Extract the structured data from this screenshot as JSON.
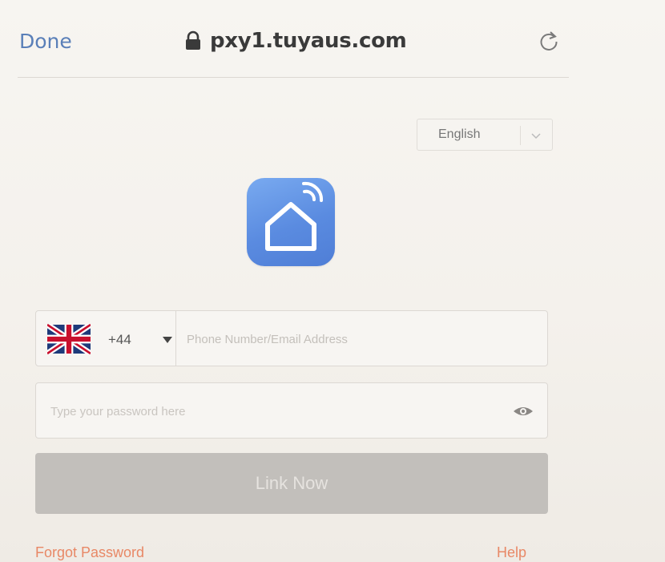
{
  "browser": {
    "done_label": "Done",
    "url": "pxy1.tuyaus.com",
    "lock_icon": "lock-icon",
    "reload_icon": "reload-icon"
  },
  "language": {
    "selected": "English",
    "icon": "chevron-down-icon"
  },
  "logo": {
    "icon": "smart-home-icon",
    "colors": {
      "from": "#79aaf0",
      "to": "#4f7ed6"
    }
  },
  "login": {
    "country_flag": "uk-flag-icon",
    "country_code": "+44",
    "phone_placeholder": "Phone Number/Email Address",
    "password_placeholder": "Type your password here",
    "eye_icon": "eye-icon",
    "submit_label": "Link Now",
    "forgot_label": "Forgot Password",
    "help_label": "Help"
  },
  "colors": {
    "link": "#5a7fb8",
    "accent": "#e88866",
    "button_disabled": "#c2bfbb"
  }
}
